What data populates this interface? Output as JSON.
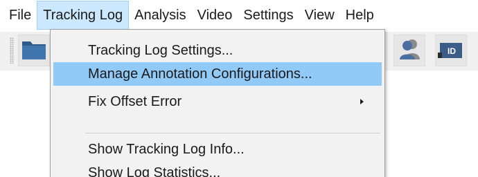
{
  "menubar": {
    "items": [
      {
        "label": "File"
      },
      {
        "label": "Tracking Log",
        "active": true
      },
      {
        "label": "Analysis"
      },
      {
        "label": "Video"
      },
      {
        "label": "Settings"
      },
      {
        "label": "View"
      },
      {
        "label": "Help"
      }
    ]
  },
  "toolbar": {
    "buttons": [
      {
        "icon": "folder-icon"
      },
      {
        "icon": "users-icon"
      },
      {
        "icon": "id-tag-icon",
        "text": "ID"
      }
    ]
  },
  "dropdown": {
    "items": [
      {
        "label": "Tracking Log Settings..."
      },
      {
        "label": "Manage Annotation Configurations...",
        "highlighted": true
      },
      {
        "label": "Fix Offset Error",
        "has_submenu": true
      },
      {
        "label": "Show Tracking Log Info..."
      },
      {
        "label": "Show Log Statistics..."
      }
    ]
  },
  "colors": {
    "active_menu_bg": "#cce8ff",
    "highlight_bg": "#91c9f7",
    "toolbar_bg": "#f0f0f0",
    "dropdown_bg": "#f2f2f2"
  }
}
